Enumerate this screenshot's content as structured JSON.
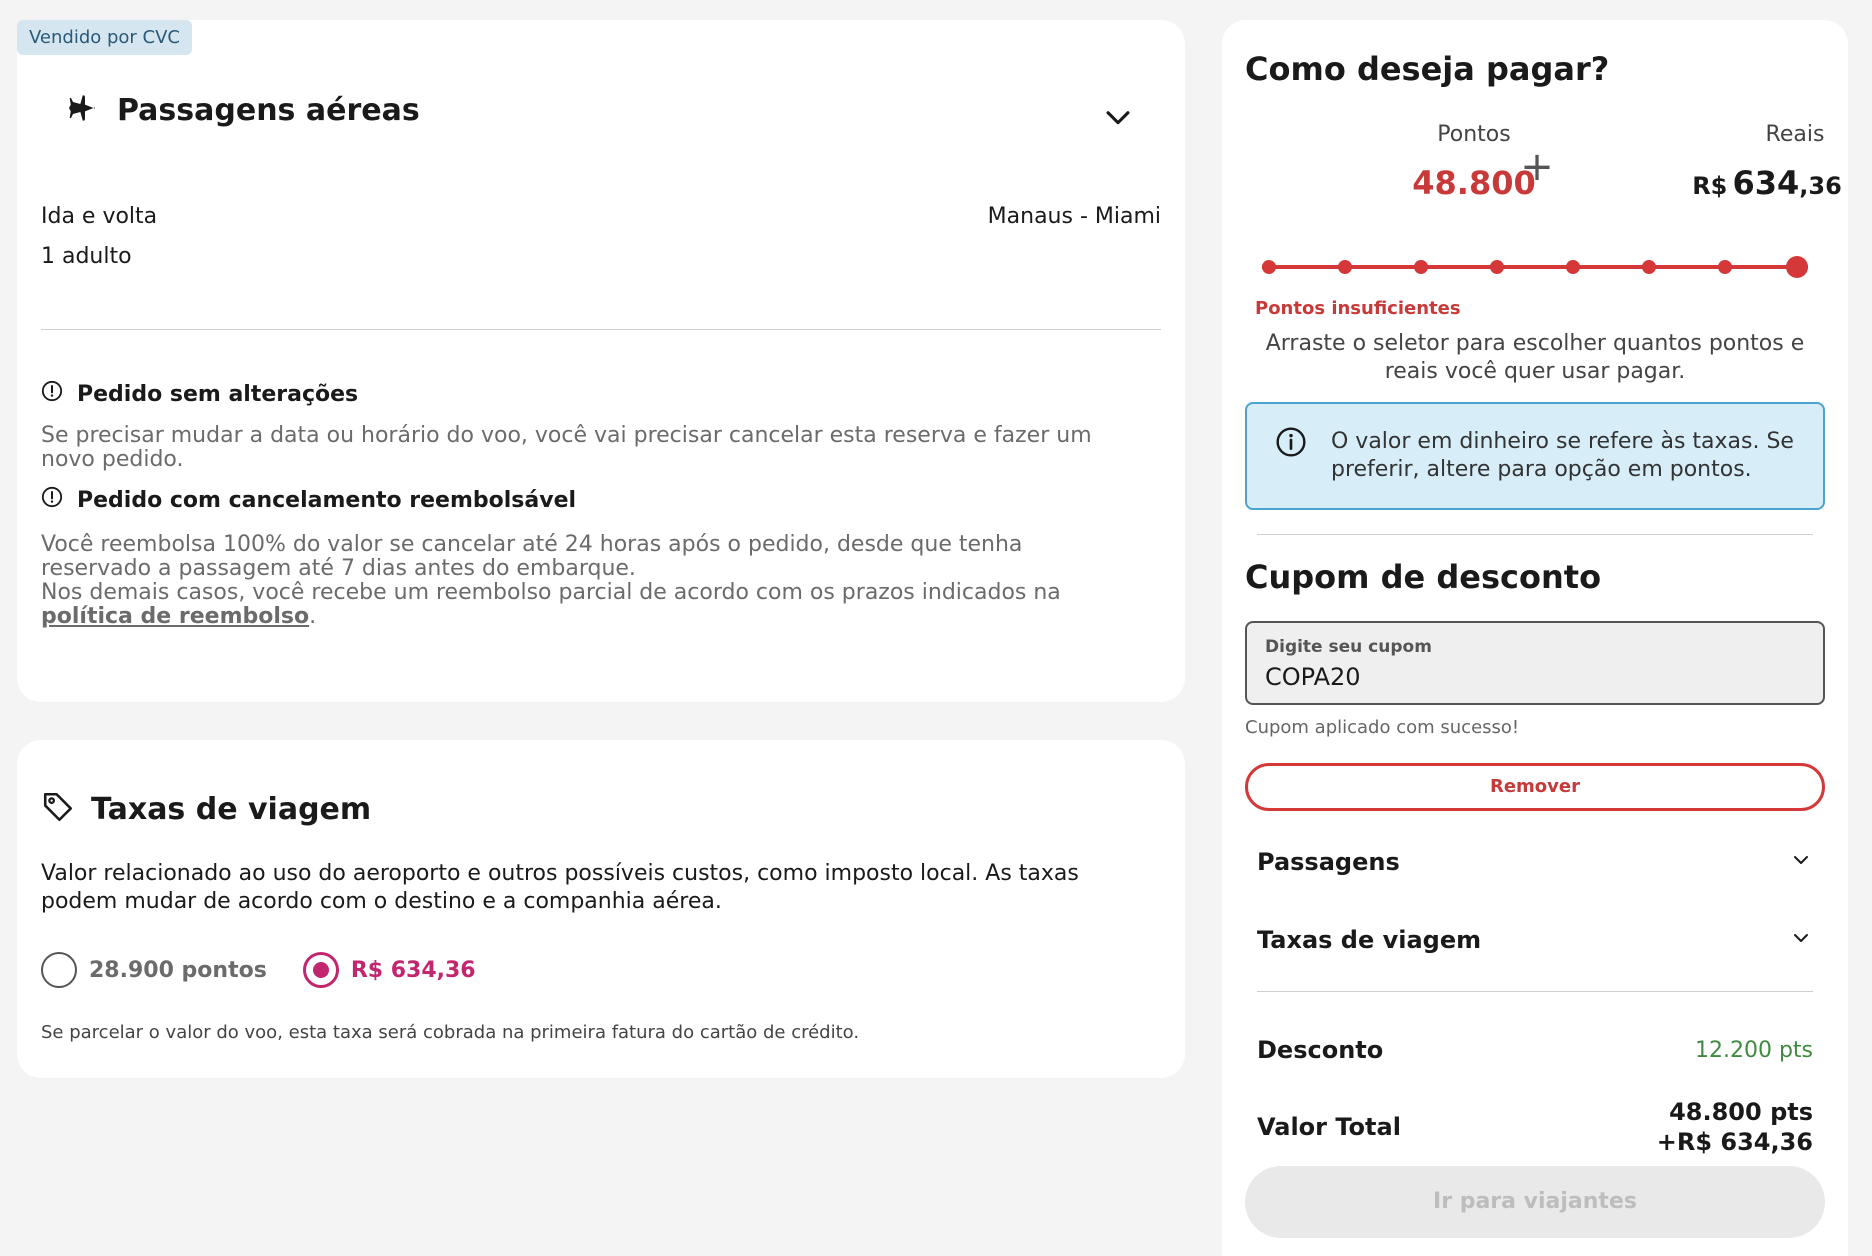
{
  "flight": {
    "vendor_badge": "Vendido por CVC",
    "title": "Passagens aéreas",
    "trip_type": "Ida e volta",
    "route": "Manaus - Miami",
    "passengers": "1 adulto",
    "policies": [
      {
        "title": "Pedido sem alterações",
        "text": "Se precisar mudar a data ou horário do voo, você vai precisar cancelar esta reserva e fazer um novo pedido."
      },
      {
        "title": "Pedido com cancelamento reembolsável",
        "text_1": "Você reembolsa 100% do valor se cancelar até 24 horas após o pedido, desde que tenha reservado a passagem até 7 dias antes do embarque.",
        "text_2": "Nos demais casos, você recebe um reembolso parcial de acordo com os prazos indicados na ",
        "link": "política de reembolso",
        "text_3": "."
      }
    ]
  },
  "taxes": {
    "title": "Taxas de viagem",
    "description": "Valor relacionado ao uso do aeroporto e outros possíveis custos, como imposto local. As taxas podem mudar de acordo com o destino e a companhia aérea.",
    "option_points": "28.900 pontos",
    "option_reais": "R$ 634,36",
    "selected": "reais",
    "note": "Se parcelar o valor do voo, esta taxa será cobrada na primeira fatura do cartão de crédito."
  },
  "payment": {
    "title": "Como deseja pagar?",
    "points_label": "Pontos",
    "points_value": "48.800",
    "plus": "+",
    "reais_label": "Reais",
    "reais_currency": "R$",
    "reais_int": "634",
    "reais_dec": ",36",
    "slider_position": 1.0,
    "slider_steps": 8,
    "warning": "Pontos insuficientes",
    "slider_help": "Arraste o seletor para escolher quantos pontos e reais você quer usar pagar.",
    "info": "O valor em dinheiro se refere às taxas. Se preferir, altere para opção em pontos."
  },
  "coupon": {
    "title": "Cupom de desconto",
    "field_label": "Digite seu cupom",
    "value": "COPA20",
    "success": "Cupom aplicado com sucesso!",
    "remove_label": "Remover"
  },
  "summary": {
    "tickets_label": "Passagens",
    "taxes_label": "Taxas de viagem",
    "discount_label": "Desconto",
    "discount_value": "12.200 pts",
    "total_label": "Valor Total",
    "total_points": "48.800 pts",
    "total_reais": "+R$ 634,36",
    "cta_label": "Ir para viajantes"
  },
  "colors": {
    "accent_red": "#d43838",
    "radio_pink": "#c2266f",
    "discount_green": "#3f8b3f",
    "info_bg": "#d7eef8"
  }
}
